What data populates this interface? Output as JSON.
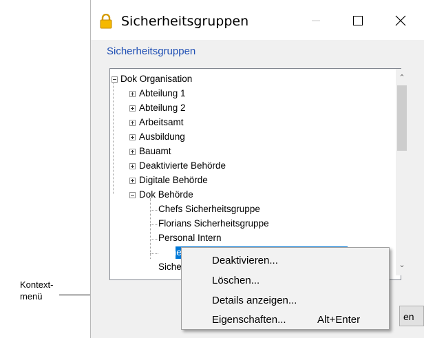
{
  "window": {
    "title": "Sicherheitsgruppen",
    "icon": "lock-icon",
    "controls": [
      "minimize-icon",
      "maximize-icon",
      "close-icon"
    ]
  },
  "section_link": "Sicherheitsgruppen",
  "tree": {
    "items": [
      {
        "label": "Dok Organisation",
        "expander": "minus"
      },
      {
        "label": "Abteilung 1",
        "expander": "plus"
      },
      {
        "label": "Abteilung 2",
        "expander": "plus"
      },
      {
        "label": "Arbeitsamt",
        "expander": "plus"
      },
      {
        "label": "Ausbildung",
        "expander": "plus"
      },
      {
        "label": "Bauamt",
        "expander": "plus"
      },
      {
        "label": "Deaktivierte Behörde",
        "expander": "plus"
      },
      {
        "label": "Digitale Behörde",
        "expander": "plus"
      },
      {
        "label": "Dok Behörde",
        "expander": "minus"
      },
      {
        "label": "Chefs Sicherheitsgruppe",
        "expander": "none"
      },
      {
        "label": "Florians Sicherheitsgruppe",
        "expander": "none"
      },
      {
        "label": "Personal Intern",
        "expander": "none"
      },
      {
        "label": "Siche",
        "expander": "none",
        "selected": true
      },
      {
        "label": "Siche",
        "expander": "none"
      }
    ]
  },
  "context_menu": {
    "items": [
      {
        "label": "Deaktivieren...",
        "shortcut": ""
      },
      {
        "label": "Löschen...",
        "shortcut": ""
      },
      {
        "label": "Details anzeigen...",
        "shortcut": ""
      },
      {
        "label": "Eigenschaften...",
        "shortcut": "Alt+Enter"
      }
    ]
  },
  "partial_button_label": "en",
  "callout": {
    "line1": "Kontext-",
    "line2": "menü"
  },
  "colors": {
    "selection": "#0078d7",
    "link": "#1f4fb4",
    "lock": "#f0b400"
  }
}
